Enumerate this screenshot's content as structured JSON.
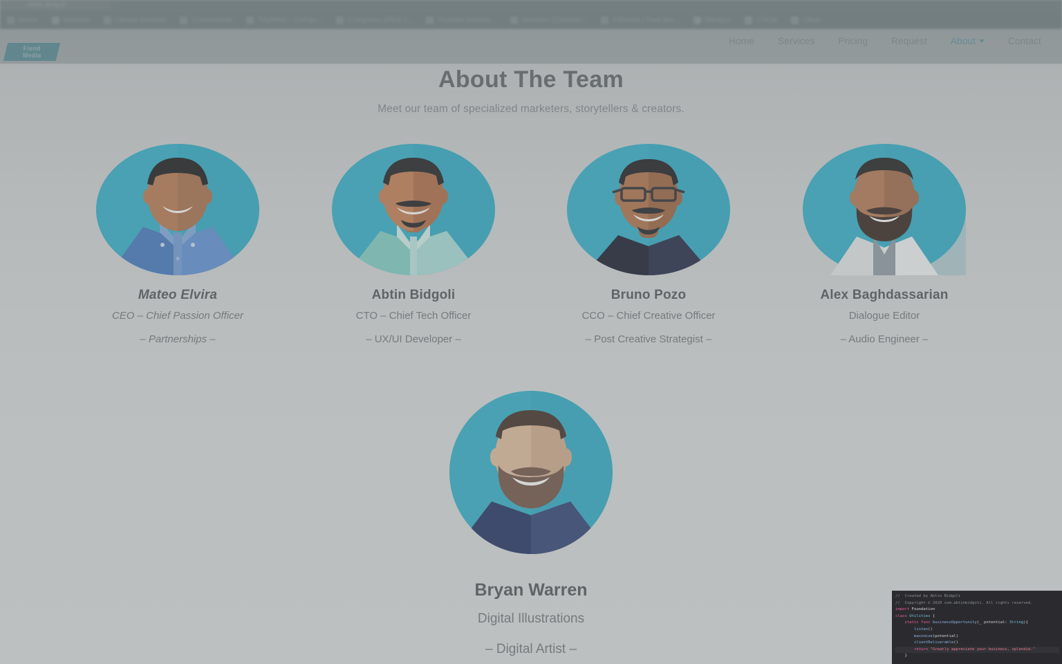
{
  "browser": {
    "tab_label": "Abtin Bidgoli",
    "bookmarks": [
      {
        "label": "Home",
        "icon": "globe-icon"
      },
      {
        "label": "Website",
        "icon": "folder-icon"
      },
      {
        "label": "Library Genesis",
        "icon": "book-icon"
      },
      {
        "label": "Screenshots",
        "icon": "camera-icon"
      },
      {
        "label": "TinyPNG – Compr...",
        "icon": "panda-icon"
      },
      {
        "label": "Compress JPEG I...",
        "icon": "image-icon"
      },
      {
        "label": "Youtube Downlo...",
        "icon": "youtube-icon"
      },
      {
        "label": "Streams Schedule...",
        "icon": "calendar-icon"
      },
      {
        "label": "FMovies | Free Mo...",
        "icon": "film-icon"
      },
      {
        "label": "Recipes",
        "icon": "folder-icon"
      },
      {
        "label": "CSUN",
        "icon": "folder-icon"
      },
      {
        "label": "Other",
        "icon": "folder-icon"
      }
    ],
    "overflow_label": "»"
  },
  "site": {
    "logo": {
      "line1": "Fiend",
      "line2": "Media"
    },
    "nav": [
      {
        "label": "Home",
        "active": false,
        "has_caret": false
      },
      {
        "label": "Services",
        "active": false,
        "has_caret": false
      },
      {
        "label": "Pricing",
        "active": false,
        "has_caret": false
      },
      {
        "label": "Request",
        "active": false,
        "has_caret": false
      },
      {
        "label": "About",
        "active": true,
        "has_caret": true
      },
      {
        "label": "Contact",
        "active": false,
        "has_caret": false
      }
    ]
  },
  "main": {
    "title": "About The Team",
    "subtitle": "Meet our team of specialized marketers, storytellers & creators.",
    "team": [
      {
        "name": "Mateo Elvira",
        "role": "CEO – Chief Passion Officer",
        "specialty": "– Partnerships –",
        "avatar": "avatar-mateo",
        "italic": true
      },
      {
        "name": "Abtin Bidgoli",
        "role": "CTO – Chief Tech Officer",
        "specialty": "– UX/UI Developer –",
        "avatar": "avatar-abtin",
        "italic": false
      },
      {
        "name": "Bruno Pozo",
        "role": "CCO – Chief Creative Officer",
        "specialty": "– Post Creative Strategist –",
        "avatar": "avatar-bruno",
        "italic": false
      },
      {
        "name": "Alex Baghdassarian",
        "role": "Dialogue Editor",
        "specialty": "– Audio Engineer –",
        "avatar": "avatar-alex",
        "italic": false
      }
    ],
    "featured": {
      "name": "Bryan Warren",
      "role": "Digital Illustrations",
      "specialty": "– Digital Artist –",
      "avatar": "avatar-bryan"
    }
  },
  "code_overlay": {
    "lines": [
      {
        "highlight": false,
        "tokens": [
          {
            "t": "//  Created by Abtin Bidgoli",
            "c": "c-com"
          }
        ]
      },
      {
        "highlight": false,
        "tokens": [
          {
            "t": "//  Copyright © 2020 com.abtinbidgoli. All rights reserved.",
            "c": "c-com"
          }
        ]
      },
      {
        "highlight": false,
        "tokens": [
          {
            "t": "import ",
            "c": "c-kw"
          },
          {
            "t": "Foundation",
            "c": "c-pl"
          }
        ]
      },
      {
        "highlight": false,
        "tokens": [
          {
            "t": "class ",
            "c": "c-kw"
          },
          {
            "t": "Utilities ",
            "c": "c-typ"
          },
          {
            "t": "{",
            "c": "c-pl"
          }
        ]
      },
      {
        "highlight": false,
        "tokens": [
          {
            "t": "    static func ",
            "c": "c-kw"
          },
          {
            "t": "businessOpportunity",
            "c": "c-fn"
          },
          {
            "t": "(",
            "c": "c-pl"
          },
          {
            "t": "_ potential",
            "c": "c-pl"
          },
          {
            "t": ": ",
            "c": "c-pl"
          },
          {
            "t": "String",
            "c": "c-typ"
          },
          {
            "t": "){",
            "c": "c-pl"
          }
        ]
      },
      {
        "highlight": false,
        "tokens": [
          {
            "t": "        ",
            "c": "c-pl"
          },
          {
            "t": "listen",
            "c": "c-fn"
          },
          {
            "t": "()",
            "c": "c-pl"
          }
        ]
      },
      {
        "highlight": false,
        "tokens": [
          {
            "t": "        ",
            "c": "c-pl"
          },
          {
            "t": "maximize",
            "c": "c-fn"
          },
          {
            "t": "(potential)",
            "c": "c-pl"
          }
        ]
      },
      {
        "highlight": false,
        "tokens": [
          {
            "t": "        ",
            "c": "c-pl"
          },
          {
            "t": "clientDeliverable",
            "c": "c-fn"
          },
          {
            "t": "()",
            "c": "c-pl"
          }
        ]
      },
      {
        "highlight": true,
        "tokens": [
          {
            "t": "        ",
            "c": "c-pl"
          },
          {
            "t": "return ",
            "c": "c-kw"
          },
          {
            "t": "\"Greatly appreciate your business, splendid.\"",
            "c": "c-str"
          }
        ]
      },
      {
        "highlight": false,
        "tokens": [
          {
            "t": "    }",
            "c": "c-pl"
          }
        ]
      }
    ]
  },
  "colors": {
    "accent_teal": "#2cafca",
    "nav_active": "#59a3b5",
    "logo_bg": "#4e93a4",
    "title_text": "#5b6063",
    "body_text": "#6f7477",
    "code_bg": "#2b2b2f"
  }
}
